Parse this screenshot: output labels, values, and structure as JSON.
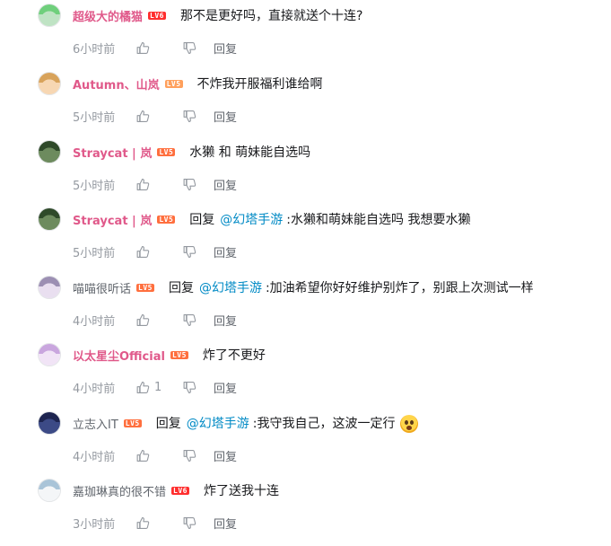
{
  "comments": [
    {
      "user": "超级大的橘猫",
      "level": "LV6",
      "level_class": "lv6",
      "vip": true,
      "reply_prefix": "",
      "mention": "",
      "text": "那不是更好吗，直接就送个十连?",
      "time": "6小时前",
      "likes": "",
      "reply_label": "回复",
      "avatar_color": "#bfe3c4",
      "avatar_hair": "#6fcf7c",
      "emoji": false
    },
    {
      "user": "Autumn、山岚",
      "level": "LV5",
      "level_class": "lv5o",
      "vip": true,
      "reply_prefix": "",
      "mention": "",
      "text": "不炸我开服福利谁给啊",
      "time": "5小时前",
      "likes": "",
      "reply_label": "回复",
      "avatar_color": "#f7d7b3",
      "avatar_hair": "#d8a35b",
      "emoji": false
    },
    {
      "user": "Straycat | 岚",
      "level": "LV5",
      "level_class": "lv5",
      "vip": true,
      "reply_prefix": "",
      "mention": "",
      "text": "水獭 和 萌妹能自选吗",
      "time": "5小时前",
      "likes": "",
      "reply_label": "回复",
      "avatar_color": "#6d8b5e",
      "avatar_hair": "#2f4a2a",
      "emoji": false
    },
    {
      "user": "Straycat | 岚",
      "level": "LV5",
      "level_class": "lv5",
      "vip": true,
      "reply_prefix": "回复",
      "mention": "@幻塔手游",
      "text": ":水獭和萌妹能自选吗  我想要水獭",
      "time": "5小时前",
      "likes": "",
      "reply_label": "回复",
      "avatar_color": "#6d8b5e",
      "avatar_hair": "#2f4a2a",
      "emoji": false
    },
    {
      "user": "喵喵很听话",
      "level": "LV5",
      "level_class": "lv5",
      "vip": false,
      "reply_prefix": "回复",
      "mention": "@幻塔手游",
      "text": ":加油希望你好好维护别炸了，别跟上次测试一样",
      "time": "4小时前",
      "likes": "",
      "reply_label": "回复",
      "avatar_color": "#e9dff0",
      "avatar_hair": "#9c8fb3",
      "emoji": false
    },
    {
      "user": "以太星尘Official",
      "level": "LV5",
      "level_class": "lv5",
      "vip": true,
      "reply_prefix": "",
      "mention": "",
      "text": "炸了不更好",
      "time": "4小时前",
      "likes": "1",
      "reply_label": "回复",
      "avatar_color": "#f1e4f6",
      "avatar_hair": "#c9a6de",
      "emoji": false
    },
    {
      "user": "立志入IT",
      "level": "LV5",
      "level_class": "lv5",
      "vip": false,
      "reply_prefix": "回复",
      "mention": "@幻塔手游",
      "text": ":我守我自己，这波一定行",
      "time": "4小时前",
      "likes": "",
      "reply_label": "回复",
      "avatar_color": "#3c4a86",
      "avatar_hair": "#1d2450",
      "emoji": true
    },
    {
      "user": "嘉珈琳真的很不错",
      "level": "LV6",
      "level_class": "lv6",
      "vip": false,
      "reply_prefix": "",
      "mention": "",
      "text": "炸了送我十连",
      "time": "3小时前",
      "likes": "",
      "reply_label": "回复",
      "avatar_color": "#f4f6f8",
      "avatar_hair": "#a9c4d8",
      "emoji": false
    }
  ]
}
